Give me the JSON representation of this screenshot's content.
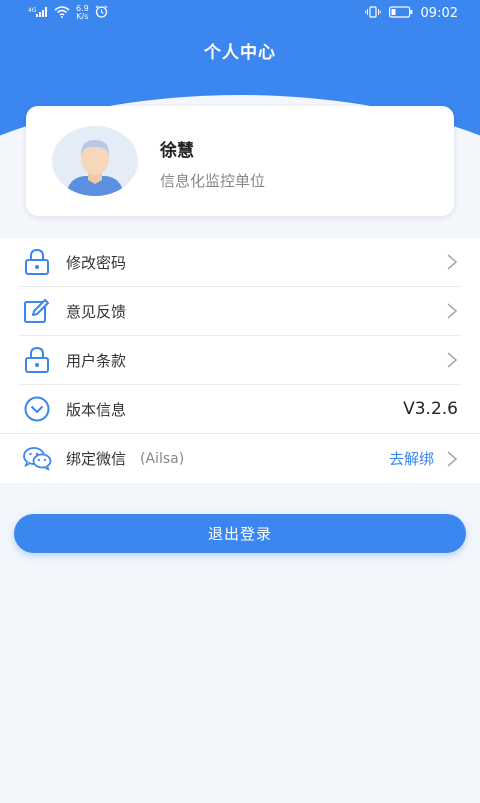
{
  "status_bar": {
    "network": "4G",
    "speed_value": "6.9",
    "speed_unit": "K/s",
    "time": "09:02"
  },
  "header": {
    "title": "个人中心"
  },
  "profile": {
    "name": "徐慧",
    "organization": "信息化监控单位"
  },
  "menu": {
    "change_password": "修改密码",
    "feedback": "意见反馈",
    "terms": "用户条款",
    "version_label": "版本信息",
    "version_value": "V3.2.6",
    "wechat_label": "绑定微信",
    "wechat_account": "(Ailsa)",
    "wechat_action": "去解绑"
  },
  "logout_label": "退出登录",
  "colors": {
    "accent": "#3b86ef",
    "background": "#f3f6fb"
  }
}
